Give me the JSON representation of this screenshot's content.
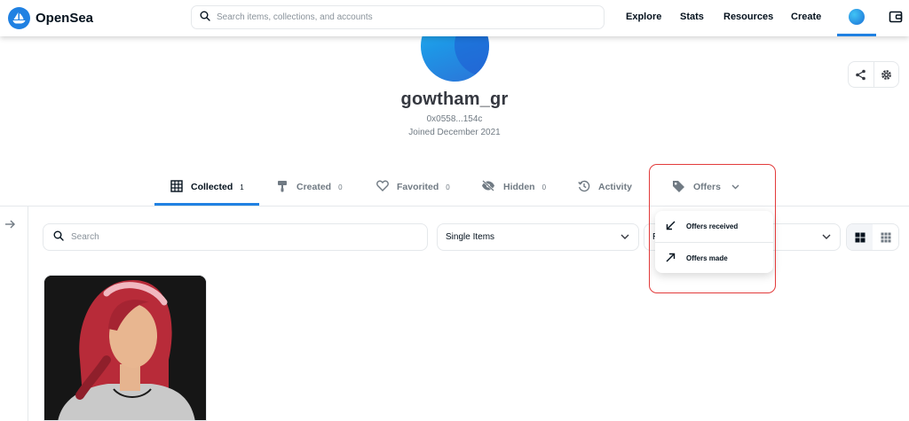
{
  "header": {
    "brand": "OpenSea",
    "search_placeholder": "Search items, collections, and accounts",
    "nav": [
      "Explore",
      "Stats",
      "Resources",
      "Create"
    ]
  },
  "profile": {
    "username": "gowtham_gr",
    "address": "0x0558...154c",
    "joined": "Joined December 2021"
  },
  "tabs": [
    {
      "label": "Collected",
      "count": "1",
      "icon": "grid-icon",
      "active": true
    },
    {
      "label": "Created",
      "count": "0",
      "icon": "paintbrush-icon"
    },
    {
      "label": "Favorited",
      "count": "0",
      "icon": "heart-icon"
    },
    {
      "label": "Hidden",
      "count": "0",
      "icon": "eye-off-icon"
    },
    {
      "label": "Activity",
      "count": "",
      "icon": "history-icon"
    },
    {
      "label": "Offers",
      "count": "",
      "icon": "tag-icon"
    }
  ],
  "filters": {
    "search_placeholder": "Search",
    "select_items": "Single Items",
    "select_sort_partial": "R"
  },
  "offers_menu": {
    "received": "Offers received",
    "made": "Offers made"
  },
  "colors": {
    "accent": "#2081e2",
    "highlight": "#e23b3b",
    "text_primary": "#04111d",
    "text_secondary": "#707a83"
  }
}
